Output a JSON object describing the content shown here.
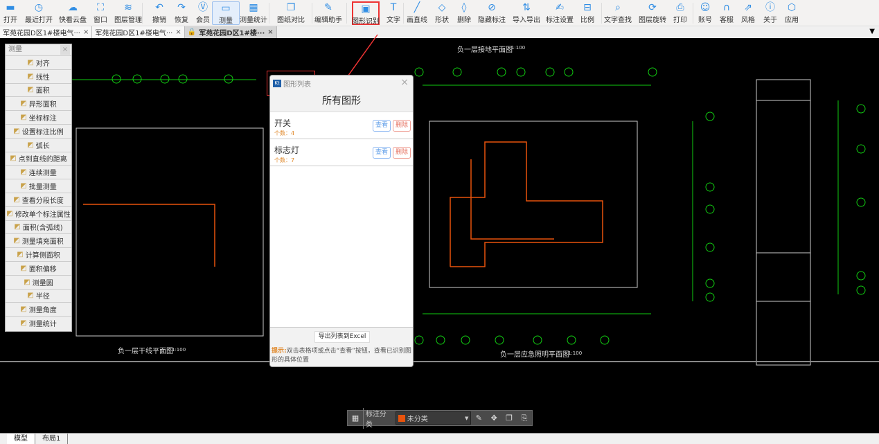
{
  "toolbar": {
    "items": [
      {
        "label": "打开",
        "icon": "folder-open-icon"
      },
      {
        "label": "最近打开",
        "icon": "history-icon"
      },
      {
        "label": "快看云盘",
        "icon": "cloud-icon"
      },
      {
        "label": "窗口",
        "icon": "window-icon"
      },
      {
        "label": "图层管理",
        "icon": "layers-icon"
      },
      {
        "label": "撤销",
        "icon": "undo-icon"
      },
      {
        "label": "恢复",
        "icon": "redo-icon"
      },
      {
        "label": "会员",
        "icon": "vip-icon"
      },
      {
        "label": "测量",
        "icon": "ruler-icon"
      },
      {
        "label": "测量统计",
        "icon": "measure-stats-icon"
      },
      {
        "label": "图纸对比",
        "icon": "compare-icon"
      },
      {
        "label": "编辑助手",
        "icon": "edit-assistant-icon"
      },
      {
        "label": "图形识别",
        "icon": "shape-recognition-icon"
      },
      {
        "label": "文字",
        "icon": "text-icon"
      },
      {
        "label": "画直线",
        "icon": "line-icon"
      },
      {
        "label": "形状",
        "icon": "shape-icon"
      },
      {
        "label": "删除",
        "icon": "eraser-icon"
      },
      {
        "label": "隐藏标注",
        "icon": "hide-icon"
      },
      {
        "label": "导入导出",
        "icon": "import-export-icon"
      },
      {
        "label": "标注设置",
        "icon": "annotation-settings-icon"
      },
      {
        "label": "比例",
        "icon": "scale-icon"
      },
      {
        "label": "文字查找",
        "icon": "text-search-icon"
      },
      {
        "label": "图层旋转",
        "icon": "rotate-icon"
      },
      {
        "label": "打印",
        "icon": "print-icon"
      },
      {
        "label": "账号",
        "icon": "user-icon"
      },
      {
        "label": "客服",
        "icon": "headset-icon"
      },
      {
        "label": "风格",
        "icon": "style-icon"
      },
      {
        "label": "关于",
        "icon": "info-icon"
      },
      {
        "label": "应用",
        "icon": "apps-icon"
      }
    ]
  },
  "tabs": [
    {
      "label": "军苑花园D区1#楼电气···"
    },
    {
      "label": "军苑花园D区1#楼电气···"
    },
    {
      "label": "军苑花园D区1#楼···",
      "locked": true
    }
  ],
  "measure_panel": {
    "title": "测量",
    "items": [
      "对齐",
      "线性",
      "面积",
      "异形面积",
      "坐标标注",
      "设置标注比例",
      "弧长",
      "点到直线的距离",
      "连续测量",
      "批量测量",
      "查看分段长度",
      "修改单个标注属性",
      "面积(含弧线)",
      "测量填充面积",
      "计算侧面积",
      "面积偏移",
      "测量圆",
      "半径",
      "测量角度",
      "测量统计"
    ]
  },
  "dialog": {
    "window_title": "图形列表",
    "heading": "所有图形",
    "rows": [
      {
        "name": "开关",
        "count": "个数：4"
      },
      {
        "name": "标志灯",
        "count": "个数：7"
      }
    ],
    "view_label": "查看",
    "delete_label": "删除",
    "export_label": "导出列表到Excel",
    "tip_label": "提示:",
    "tip_text": "双击表格项或点击“查看”按钮，查看已识别图形的具体位置"
  },
  "drawing": {
    "titles": [
      "负一层接地平面图",
      "负一层应急照明平面图",
      "负一层干线平面图"
    ],
    "scale": "1:100"
  },
  "bottom_bar": {
    "label": "标注分类",
    "category": "未分类",
    "category_color": "#e8530c"
  },
  "layout_tabs": [
    "模型",
    "布局1"
  ],
  "colors": {
    "accent": "#2f8de4",
    "highlight": "#ee3333"
  }
}
